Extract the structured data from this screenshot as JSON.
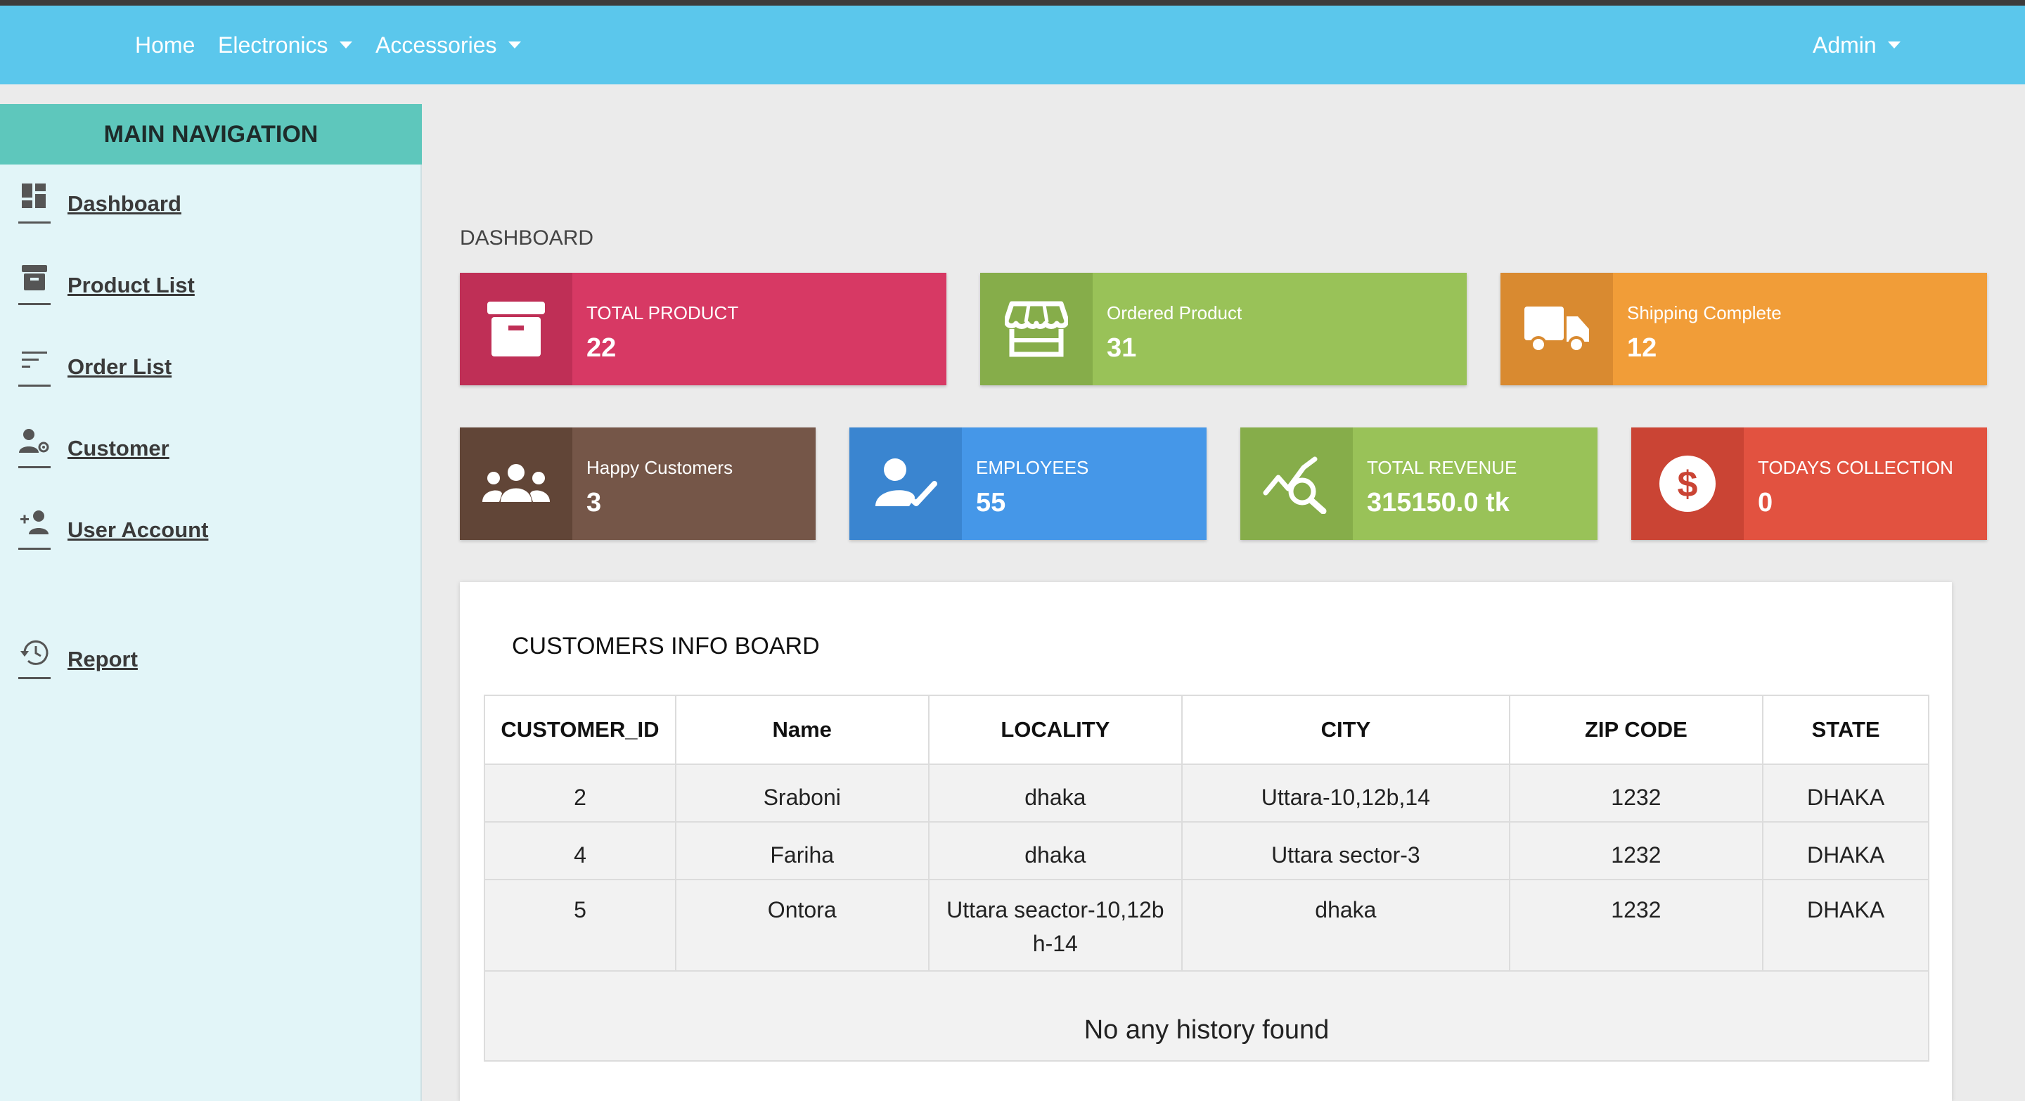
{
  "navbar": {
    "links": [
      {
        "label": "Home",
        "dropdown": false
      },
      {
        "label": "Electronics",
        "dropdown": true
      },
      {
        "label": "Accessories",
        "dropdown": true
      }
    ],
    "user": {
      "label": "Admin",
      "dropdown": true
    },
    "color": "#5bc7ec"
  },
  "sidebar": {
    "title": "MAIN NAVIGATION",
    "items": [
      {
        "label": "Dashboard",
        "icon": "dashboard-icon"
      },
      {
        "label": "Product List",
        "icon": "archive-icon"
      },
      {
        "label": "Order List",
        "icon": "sort-lines-icon"
      },
      {
        "label": "Customer",
        "icon": "user-settings-icon"
      },
      {
        "label": "User Account",
        "icon": "add-user-icon"
      },
      {
        "label": "Report",
        "icon": "history-icon"
      }
    ]
  },
  "page": {
    "title": "DASHBOARD"
  },
  "cards": [
    {
      "label": "TOTAL PRODUCT",
      "value": "22",
      "icon": "archive-box-icon",
      "color": "#d73964",
      "icon_bg": "#bf2f56"
    },
    {
      "label": "Ordered Product",
      "value": "31",
      "icon": "storefront-icon",
      "color": "#99c258",
      "icon_bg": "#86ad4a"
    },
    {
      "label": "Shipping Complete",
      "value": "12",
      "icon": "truck-icon",
      "color": "#f19d38",
      "icon_bg": "#d98a30"
    },
    {
      "label": "Happy Customers",
      "value": "3",
      "icon": "users-group-icon",
      "color": "#755648",
      "icon_bg": "#614537"
    },
    {
      "label": "EMPLOYEES",
      "value": "55",
      "icon": "user-check-icon",
      "color": "#4597e8",
      "icon_bg": "#3a85d0"
    },
    {
      "label": "TOTAL REVENUE",
      "value": "315150.0 tk",
      "icon": "chart-search-icon",
      "color": "#99c258",
      "icon_bg": "#86ad4a"
    },
    {
      "label": "TODAYS COLLECTION",
      "value": "0",
      "icon": "dollar-coin-icon",
      "color": "#e25240",
      "icon_bg": "#ca4434"
    }
  ],
  "customers": {
    "title": "CUSTOMERS INFO BOARD",
    "columns": [
      "CUSTOMER_ID",
      "Name",
      "LOCALITY",
      "CITY",
      "ZIP CODE",
      "STATE"
    ],
    "rows": [
      [
        "2",
        "Sraboni",
        "dhaka",
        "Uttara-10,12b,14",
        "1232",
        "DHAKA"
      ],
      [
        "4",
        "Fariha",
        "dhaka",
        "Uttara sector-3",
        "1232",
        "DHAKA"
      ],
      [
        "5",
        "Ontora",
        "Uttara seactor-10,12b h-14",
        "dhaka",
        "1232",
        "DHAKA"
      ]
    ],
    "empty_message": "No any history found"
  }
}
